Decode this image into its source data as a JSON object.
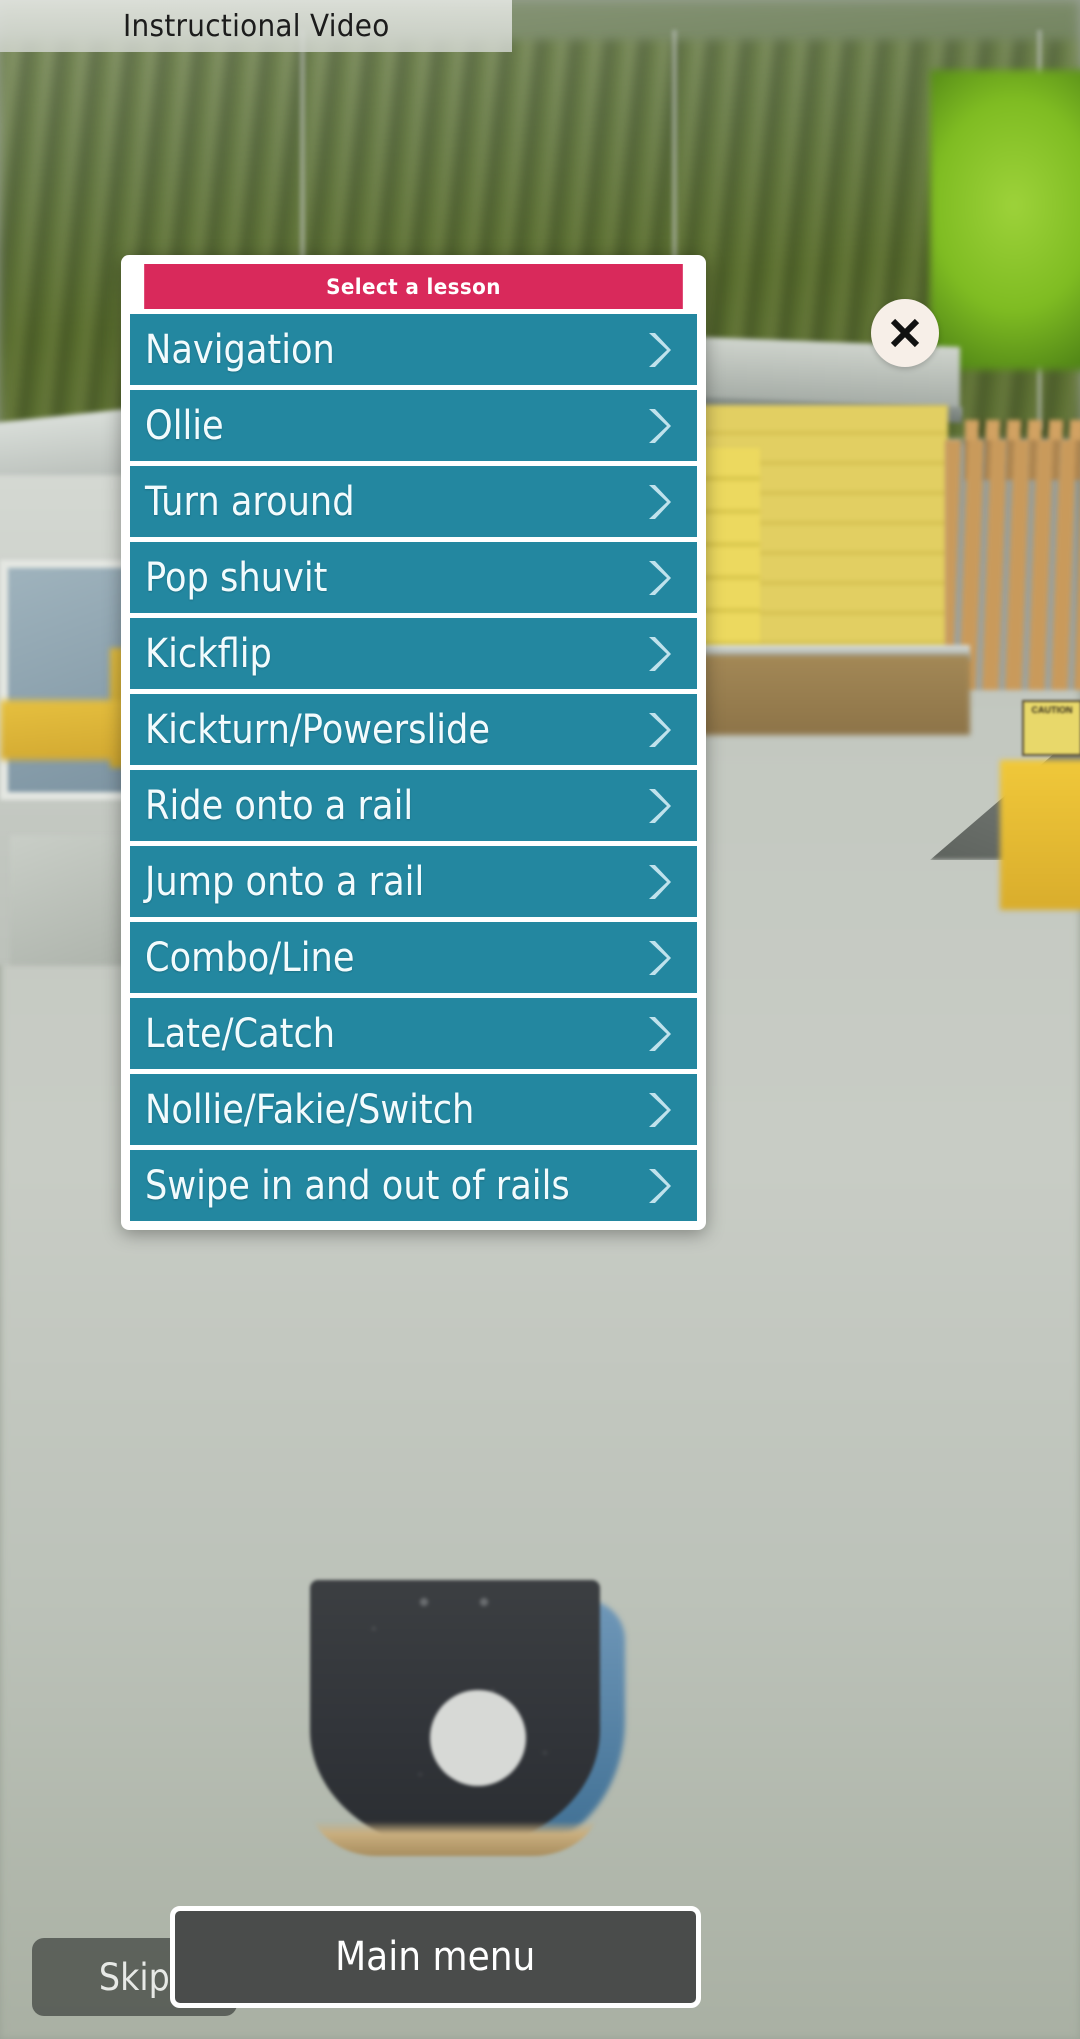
{
  "header": {
    "banner_title": "Instructional Video"
  },
  "panel": {
    "title": "Select a lesson",
    "close_label": "×",
    "accent_title_color": "#d9295b",
    "row_color": "#2387a0",
    "lessons": [
      {
        "label": "Navigation",
        "chevron": "chevron-right-icon"
      },
      {
        "label": "Ollie",
        "chevron": "chevron-right-icon"
      },
      {
        "label": "Turn around",
        "chevron": "chevron-right-icon"
      },
      {
        "label": "Pop shuvit",
        "chevron": "chevron-right-icon"
      },
      {
        "label": "Kickflip",
        "chevron": "chevron-right-icon"
      },
      {
        "label": "Kickturn/Powerslide",
        "chevron": "chevron-right-icon"
      },
      {
        "label": "Ride onto a rail",
        "chevron": "chevron-right-icon"
      },
      {
        "label": "Jump onto a rail",
        "chevron": "chevron-right-icon"
      },
      {
        "label": "Combo/Line",
        "chevron": "chevron-right-icon"
      },
      {
        "label": "Late/Catch",
        "chevron": "chevron-right-icon"
      },
      {
        "label": "Nollie/Fakie/Switch",
        "chevron": "chevron-right-icon"
      },
      {
        "label": "Swipe in and out of rails",
        "chevron": "chevron-right-icon"
      }
    ]
  },
  "footer": {
    "skip_label": "Skip",
    "main_menu_label": "Main menu"
  },
  "scene": {
    "caution_sign_text": "CAUTION"
  }
}
